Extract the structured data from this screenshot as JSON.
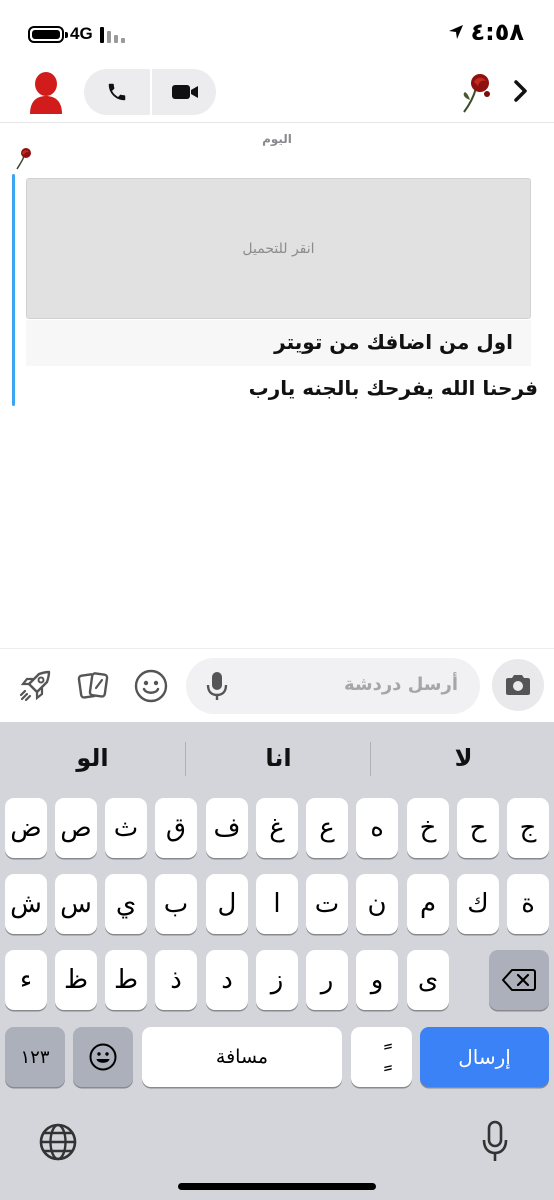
{
  "status_bar": {
    "time": "٤:٥٨",
    "network": "4G",
    "location_arrow": "location-arrow-icon"
  },
  "header": {
    "avatar_icon": "bitmoji-avatar-icon",
    "voice_call_icon": "phone-icon",
    "video_call_icon": "video-camera-icon",
    "friend_avatar_icon": "wilted-rose-icon",
    "back_icon": "chevron-right-icon"
  },
  "chat": {
    "day_label": "اليوم",
    "sender_icon": "wilted-rose-icon",
    "media_placeholder": "انقر للتحميل",
    "media_caption": "اول من اضافك من تويتر",
    "message": "فرحنا الله يفرحك بالجنه يارب"
  },
  "input_bar": {
    "placeholder": "أرسل دردشة",
    "icons": [
      "rocket-lens-icon",
      "cards-icon",
      "emoji-icon",
      "microphone-icon",
      "camera-icon"
    ]
  },
  "keyboard": {
    "suggestions": [
      "الو",
      "انا",
      "لا"
    ],
    "row1": [
      "ض",
      "ص",
      "ث",
      "ق",
      "ف",
      "غ",
      "ع",
      "ه",
      "خ",
      "ح",
      "ج"
    ],
    "row2": [
      "ش",
      "س",
      "ي",
      "ب",
      "ل",
      "ا",
      "ت",
      "ن",
      "م",
      "ك",
      "ة"
    ],
    "row3": [
      "ء",
      "ظ",
      "ط",
      "ذ",
      "د",
      "ز",
      "ر",
      "و",
      "ى"
    ],
    "numbers_label": "١٢٣",
    "space_label": "مسافة",
    "diacritic_label": "ًٍ",
    "send_label": "إرسال",
    "colors": {
      "send": "#3b82f6",
      "keyboard_bg": "#d3d5db"
    }
  }
}
